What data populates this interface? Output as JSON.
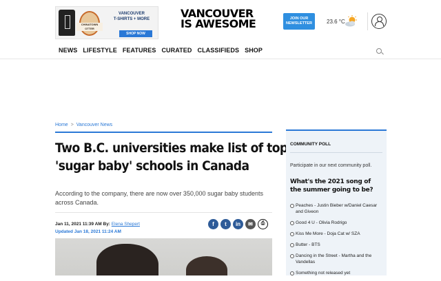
{
  "ad": {
    "badge_text": "CHINATOWN OTTER",
    "text_line1": "VANCOUVER",
    "text_line2": "T-SHIRTS + MORE",
    "shop_label": "SHOP NOW"
  },
  "header": {
    "logo_line1": "VANCOUVER",
    "logo_line2": "IS AWESOME",
    "newsletter_line1": "JOIN OUR",
    "newsletter_line2": "NEWSLETTER",
    "temperature": "23.6 °C",
    "weather_icon": "partly-sunny-icon"
  },
  "nav": {
    "items": [
      "NEWS",
      "LIFESTYLE",
      "FEATURES",
      "CURATED",
      "CLASSIFIEDS",
      "SHOP"
    ]
  },
  "breadcrumb": {
    "home": "Home",
    "separator": ">",
    "section": "Vancouver News"
  },
  "article": {
    "headline_line1": "Two B.C. universities make list of top",
    "headline_line2": "'sugar baby' schools in Canada",
    "summary": "According to the company, there are now over 350,000 sugar baby students across Canada.",
    "published": "Jan 11, 2021 11:39 AM By:",
    "author": "Elena Shepert",
    "updated": "Updated Jan 18, 2021 11:24 AM"
  },
  "share": {
    "facebook": "f",
    "twitter": "t",
    "linkedin": "in",
    "email": "✉",
    "print": "⎙"
  },
  "poll": {
    "title": "COMMUNITY POLL",
    "intro": "Participate in our next community poll.",
    "question": "What's the 2021 song of the summer going to be?",
    "options": [
      "Peaches - Justin Bieber w/Daniel Caesar and Giveon",
      "Good 4 U - Olivia Rodrigo",
      "Kiss Me More - Doja Cat w/ SZA",
      "Butter - BTS",
      "Dancing in the Street - Martha and the Vandellas",
      "Something not released yet"
    ]
  },
  "colors": {
    "accent": "#2a78d6",
    "facebook": "#2e5b98",
    "poll_background": "#eef3f8"
  }
}
